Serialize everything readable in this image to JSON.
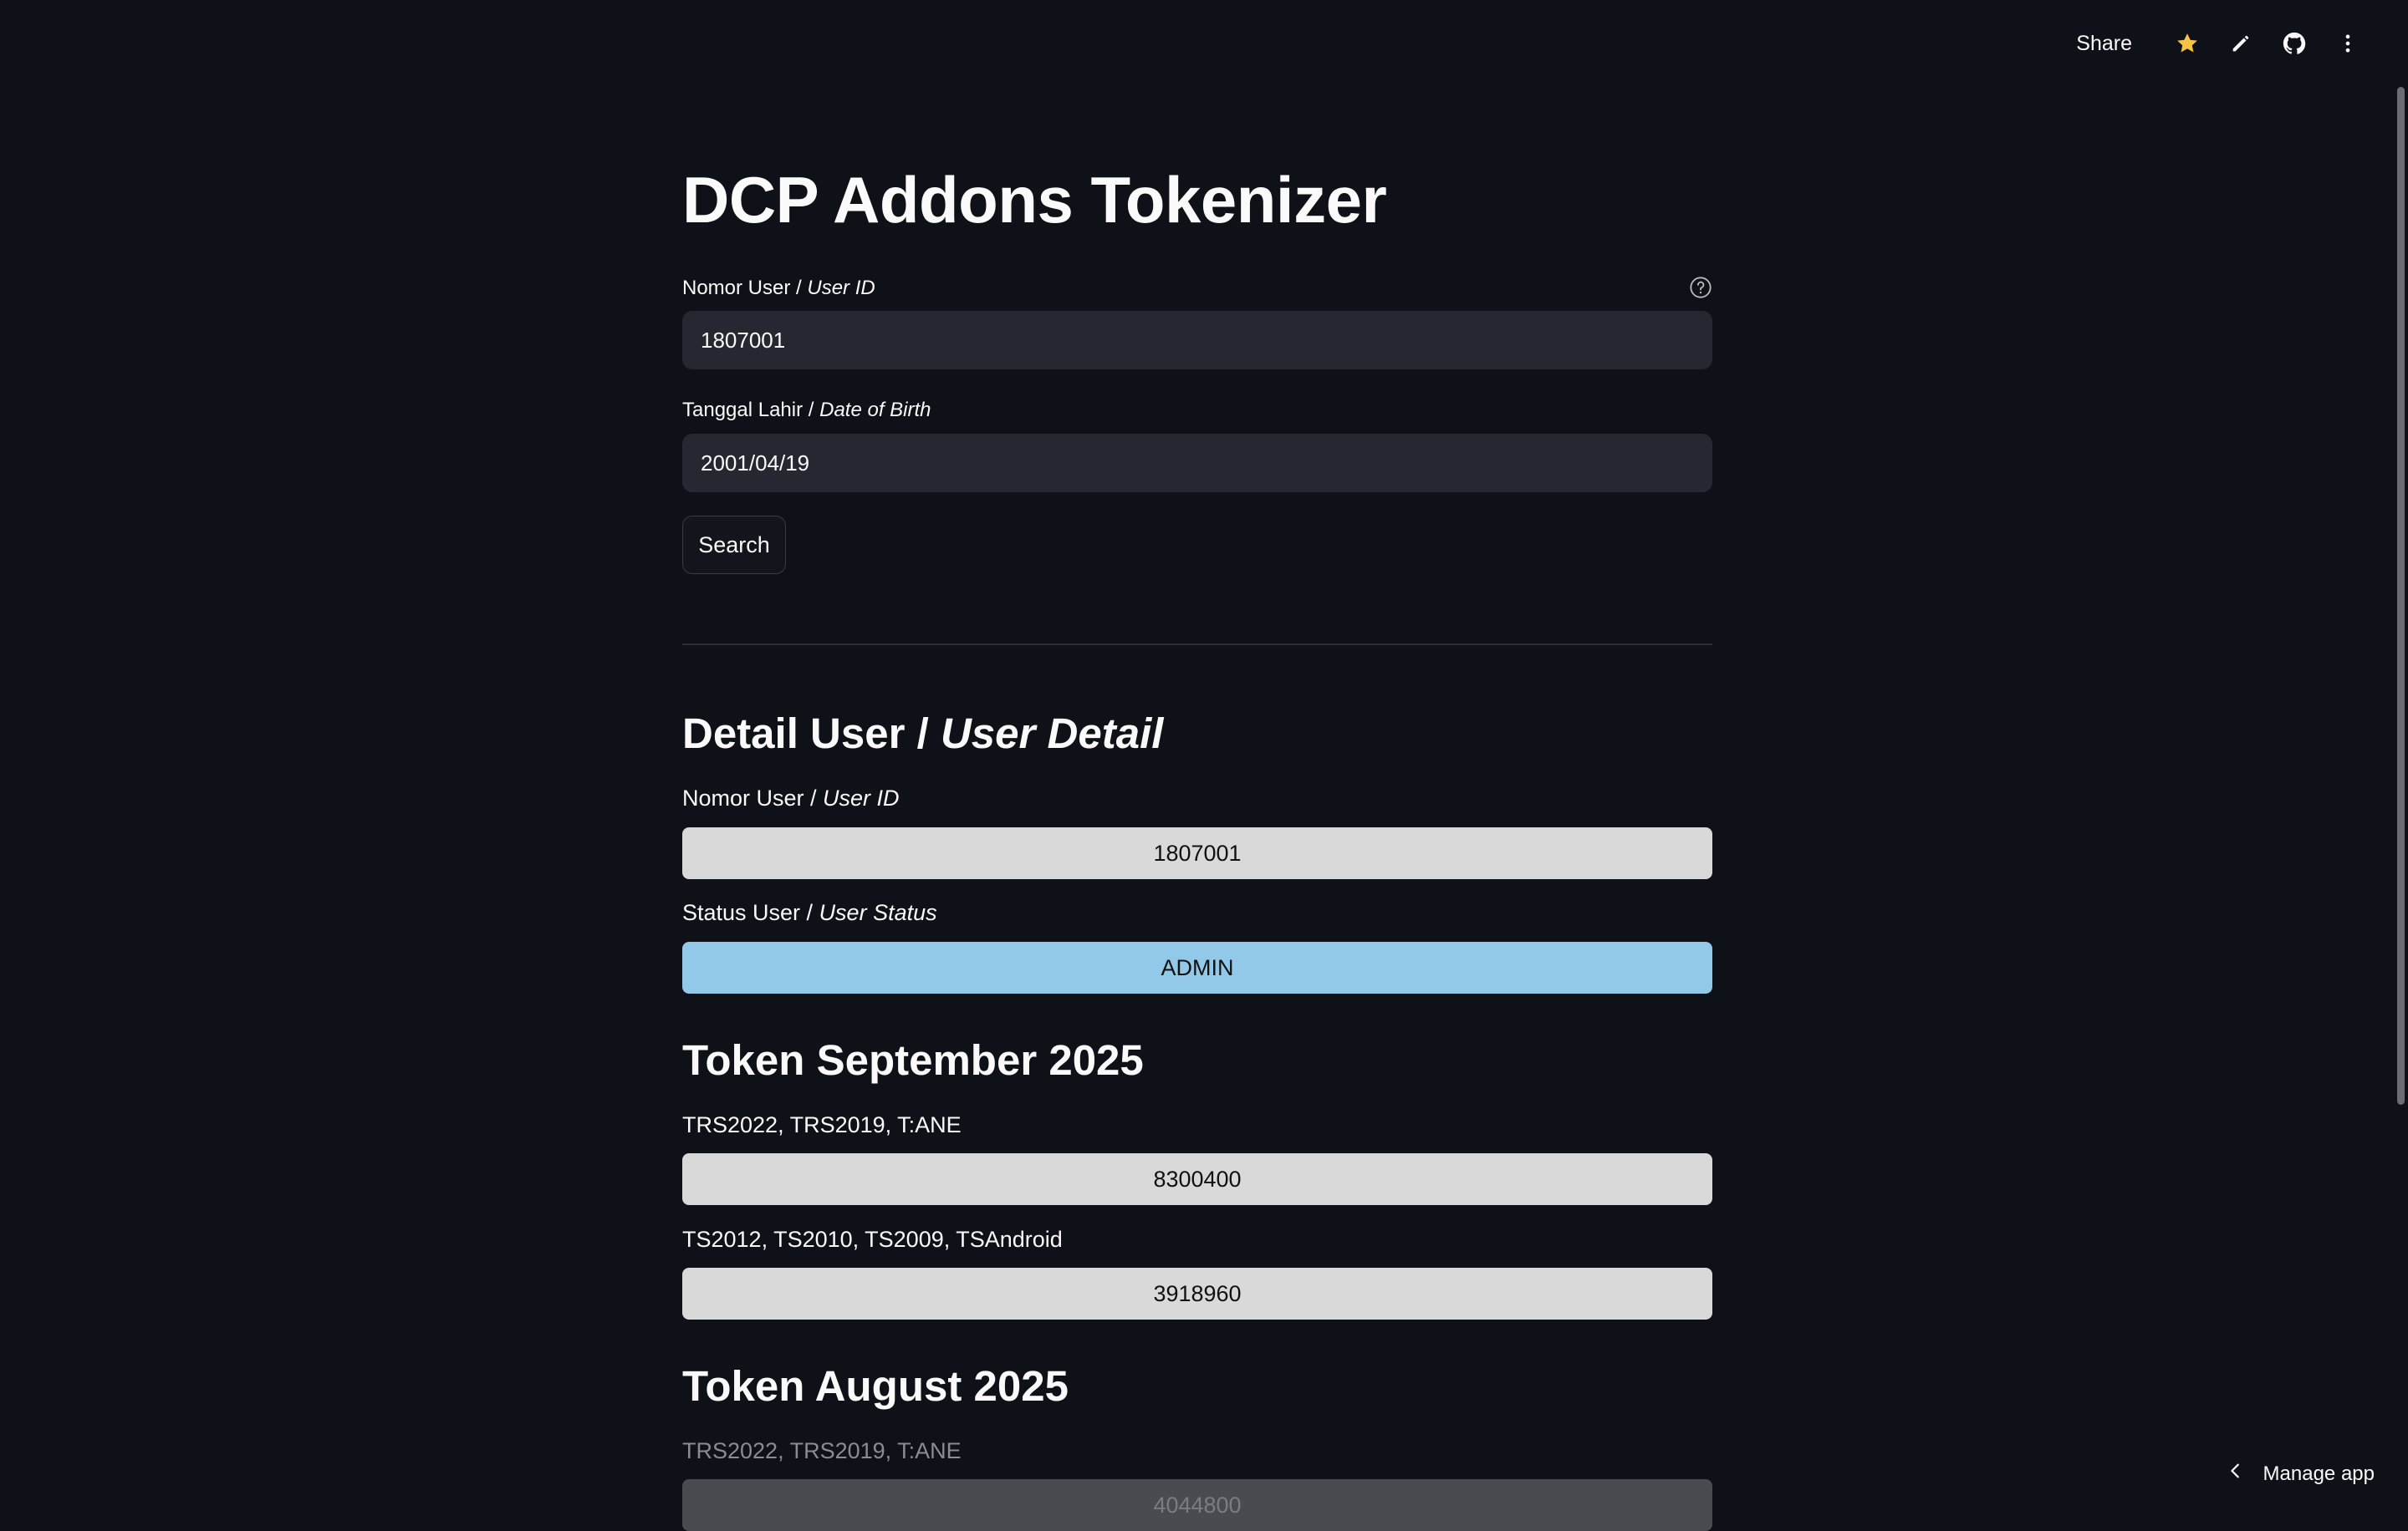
{
  "toolbar": {
    "share_label": "Share",
    "icons": [
      "star-icon",
      "pencil-icon",
      "github-icon",
      "more-vertical-icon"
    ],
    "star_color": "#f6c344"
  },
  "app": {
    "title": "DCP Addons Tokenizer"
  },
  "form": {
    "user_id_label": "Nomor User / ",
    "user_id_label_en": "User ID",
    "user_id_value": "1807001",
    "dob_label": "Tanggal Lahir / ",
    "dob_label_en": "Date of Birth",
    "dob_value": "2001/04/19",
    "search_label": "Search"
  },
  "detail": {
    "heading": "Detail User / ",
    "heading_en": "User Detail",
    "user_id_label": "Nomor User / ",
    "user_id_label_en": "User ID",
    "user_id_value": "1807001",
    "status_label": "Status User / ",
    "status_label_en": "User Status",
    "status_value": "ADMIN",
    "status_color": "#93c9e8"
  },
  "tokens": [
    {
      "heading": "Token September 2025",
      "rows": [
        {
          "label": "TRS2022, TRS2019, T:ANE",
          "value": "8300400"
        },
        {
          "label": "TS2012, TS2010, TS2009, TSAndroid",
          "value": "3918960"
        }
      ]
    },
    {
      "heading": "Token August 2025",
      "rows": [
        {
          "label": "TRS2022, TRS2019, T:ANE",
          "value": "4044800"
        }
      ]
    }
  ],
  "footer": {
    "manage_label": "Manage app"
  }
}
